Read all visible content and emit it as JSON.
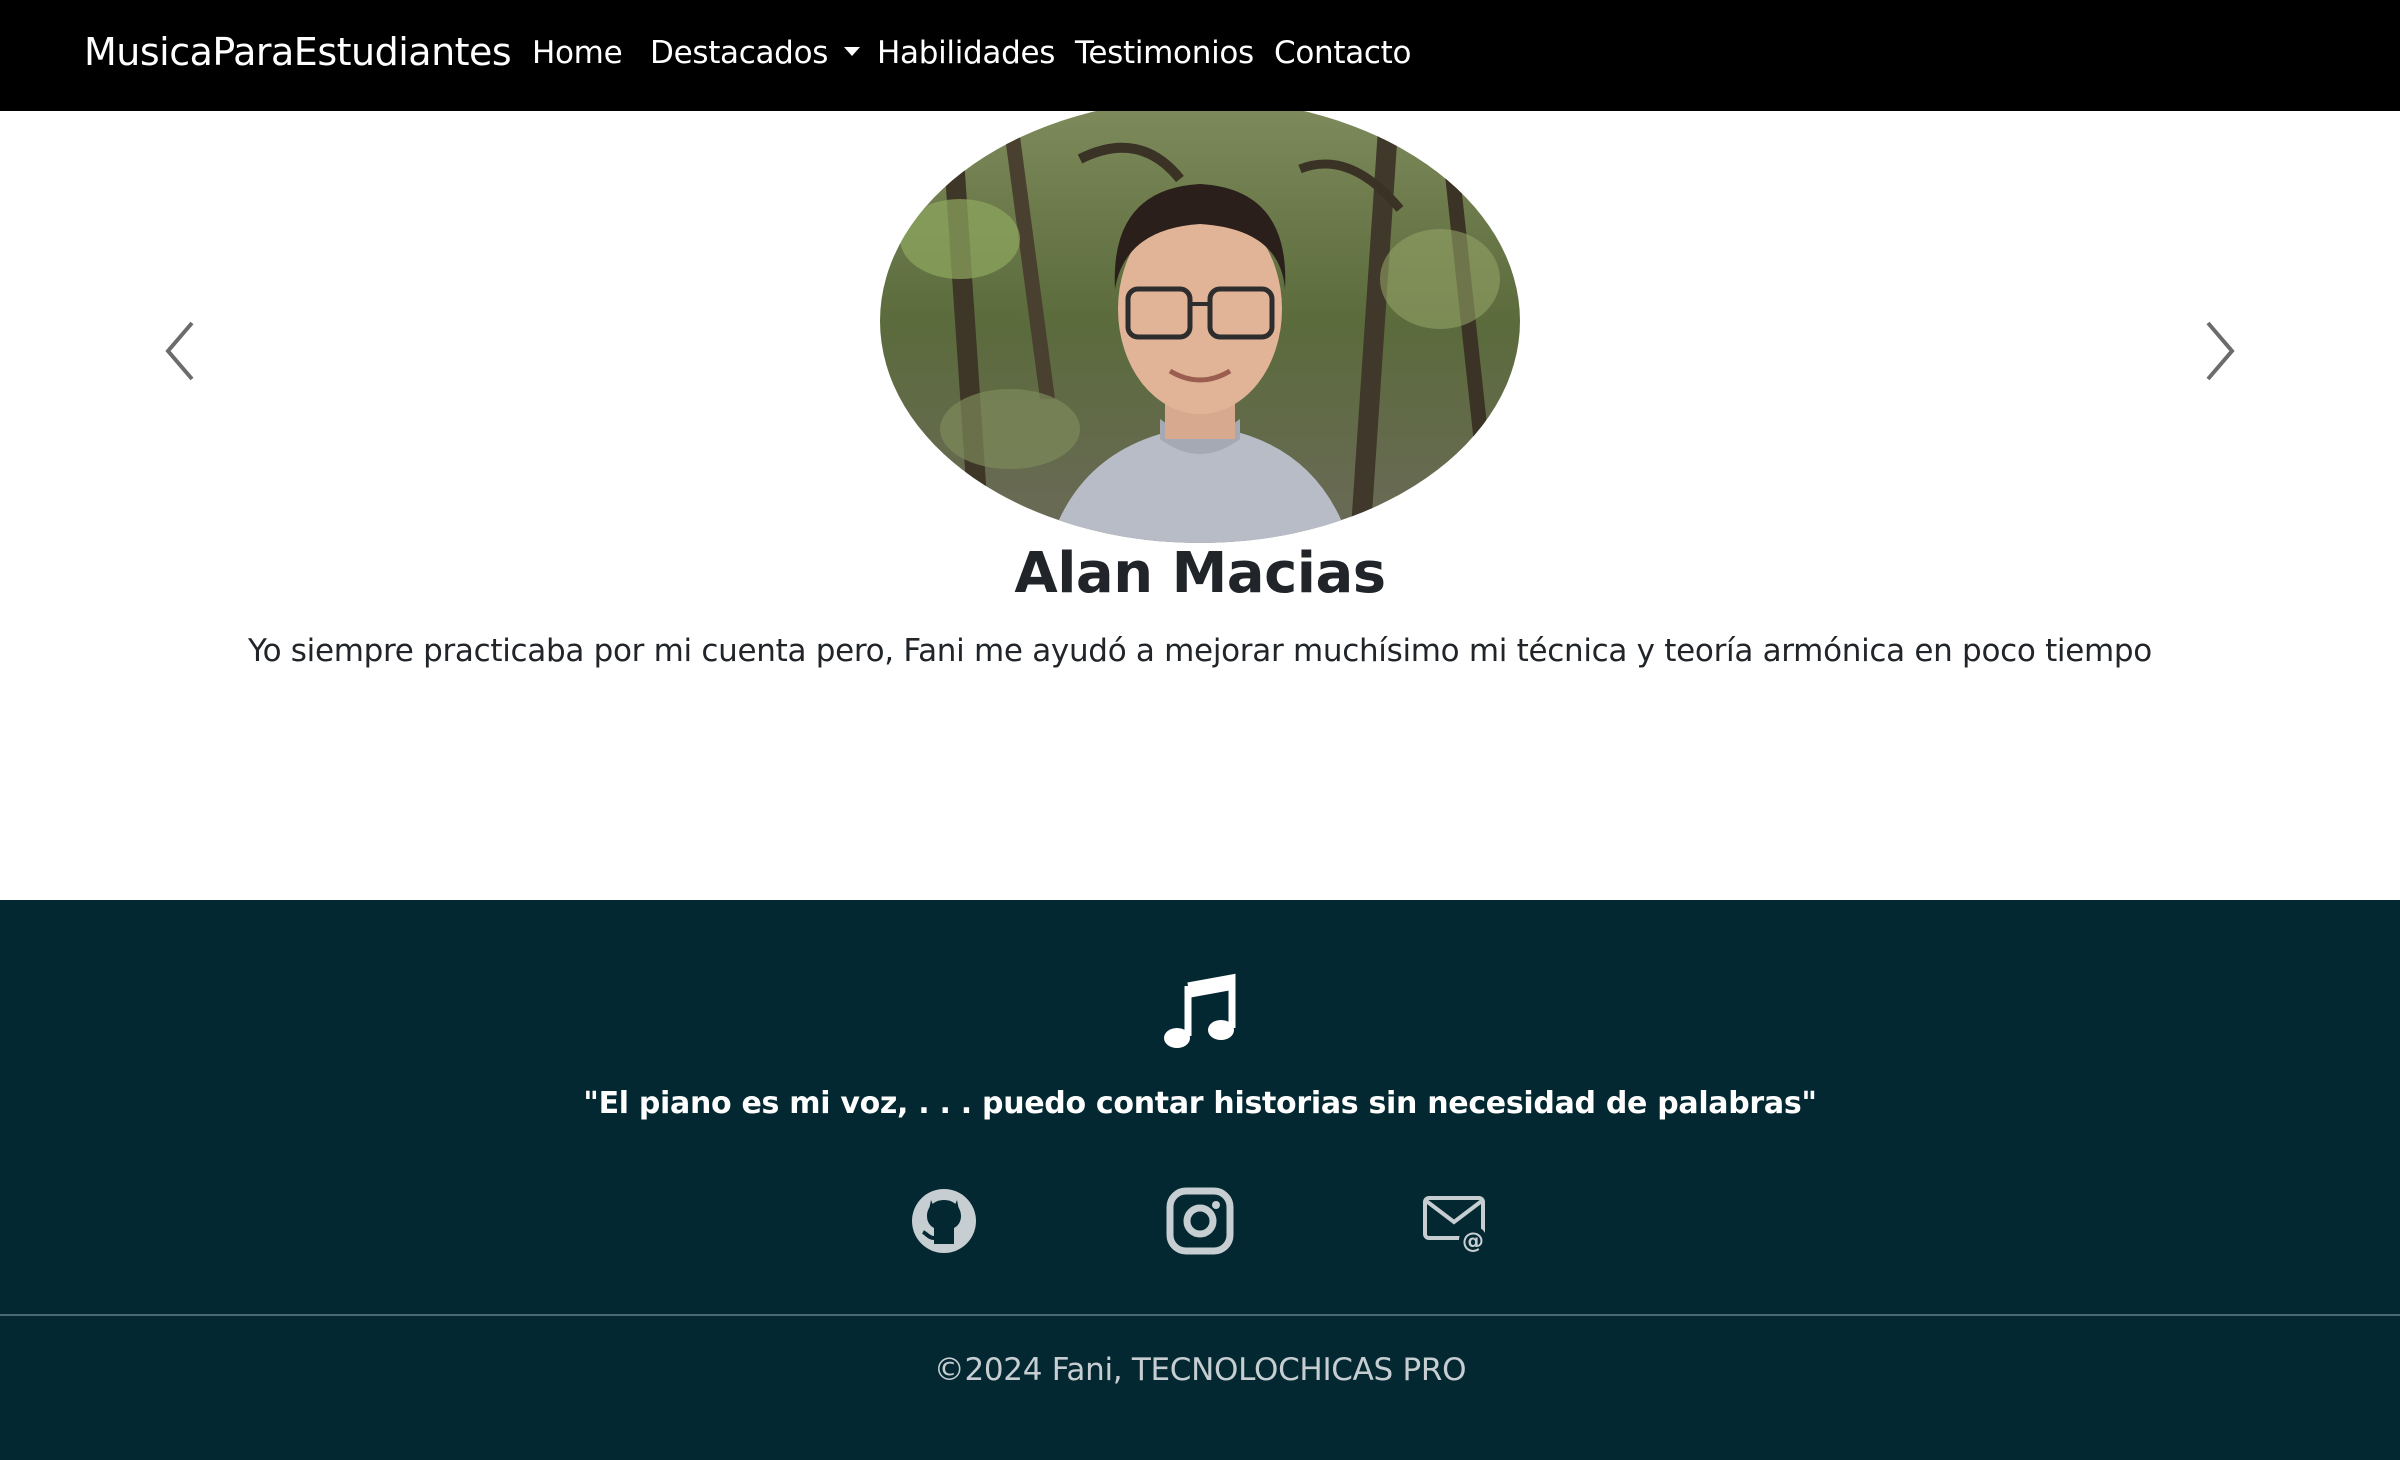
{
  "navbar": {
    "brand": "MusicaParaEstudiantes",
    "items": [
      {
        "label": "Home"
      },
      {
        "label": "Destacados"
      },
      {
        "label": "Habilidades"
      },
      {
        "label": "Testimonios"
      },
      {
        "label": "Contacto"
      }
    ],
    "dropdown_icon": "caret-down-icon"
  },
  "testimonial": {
    "name": "Alan Macias",
    "text": "Yo siempre practicaba por mi cuenta pero, Fani me ayudó a mejorar muchísimo mi técnica y teoría armónica en poco tiempo",
    "prev_icon": "chevron-left-icon",
    "next_icon": "chevron-right-icon"
  },
  "footer": {
    "icon": "music-note-icon",
    "quote": "\"El piano es mi voz, . . . puedo contar historias sin necesidad de palabras\"",
    "social_icons": [
      "github-icon",
      "instagram-icon",
      "email-icon"
    ],
    "copyright": "©2024 Fani, TECNOLOCHICAS PRO"
  },
  "colors": {
    "navbar_bg": "#000000",
    "footer_bg": "#032831",
    "text_dark": "#212529",
    "social_icon": "#c7ced2"
  }
}
